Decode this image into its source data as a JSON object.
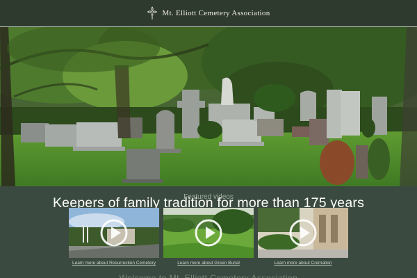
{
  "header": {
    "brand_name": "Mt. Elliott Cemetery Association",
    "logo_icon": "cross-flower-icon"
  },
  "hero": {
    "image_description": "cemetery-photo"
  },
  "main": {
    "featured_title": "Featured videos",
    "tagline": "Keepers of family tradition for more than 175 years",
    "videos": [
      {
        "link_text": "Learn more about Resurrection Cemetery",
        "icon": "play-icon"
      },
      {
        "link_text": "Learn more about Green Burial",
        "icon": "play-icon"
      },
      {
        "link_text": "Learn more about Cremation",
        "icon": "play-icon"
      }
    ],
    "welcome": "Welcome to Mt. Elliott Cemetery Association"
  },
  "colors": {
    "header_bg": "#2f3a2e",
    "band_bg": "#3b4a40",
    "text_light": "#ffffff"
  }
}
